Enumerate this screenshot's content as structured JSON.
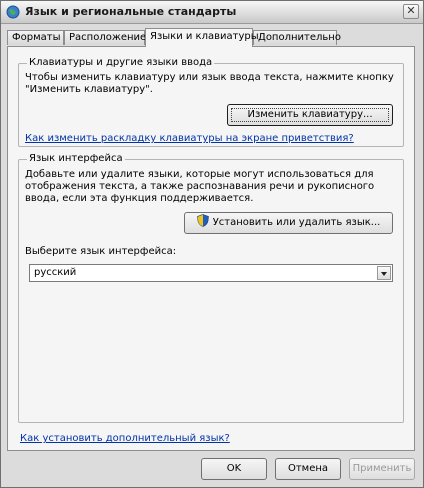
{
  "window": {
    "title": "Язык и региональные стандарты",
    "close_glyph": "✕"
  },
  "tabs": [
    {
      "label": "Форматы"
    },
    {
      "label": "Расположение"
    },
    {
      "label": "Языки и клавиатуры"
    },
    {
      "label": "Дополнительно"
    }
  ],
  "keyboards_group": {
    "legend": "Клавиатуры и другие языки ввода",
    "description_line1": "Чтобы изменить клавиатуру или язык ввода текста, нажмите кнопку",
    "description_line2": "\"Изменить клавиатуру\".",
    "change_button_label": "Изменить клавиатуру...",
    "welcome_link": "Как изменить раскладку клавиатуры на экране приветствия?"
  },
  "display_group": {
    "legend": "Язык интерфейса",
    "description_line1": "Добавьте или удалите языки, которые могут использоваться для",
    "description_line2": "отображения текста, а также распознавания речи и рукописного",
    "description_line3": "ввода, если эта функция поддерживается.",
    "install_button_label": "Установить или удалить язык...",
    "select_label": "Выберите язык интерфейса:",
    "selected_language": "русский"
  },
  "additional_link": "Как установить дополнительный язык?",
  "footer": {
    "ok_label": "OK",
    "cancel_label": "Отмена",
    "apply_label": "Применить"
  }
}
